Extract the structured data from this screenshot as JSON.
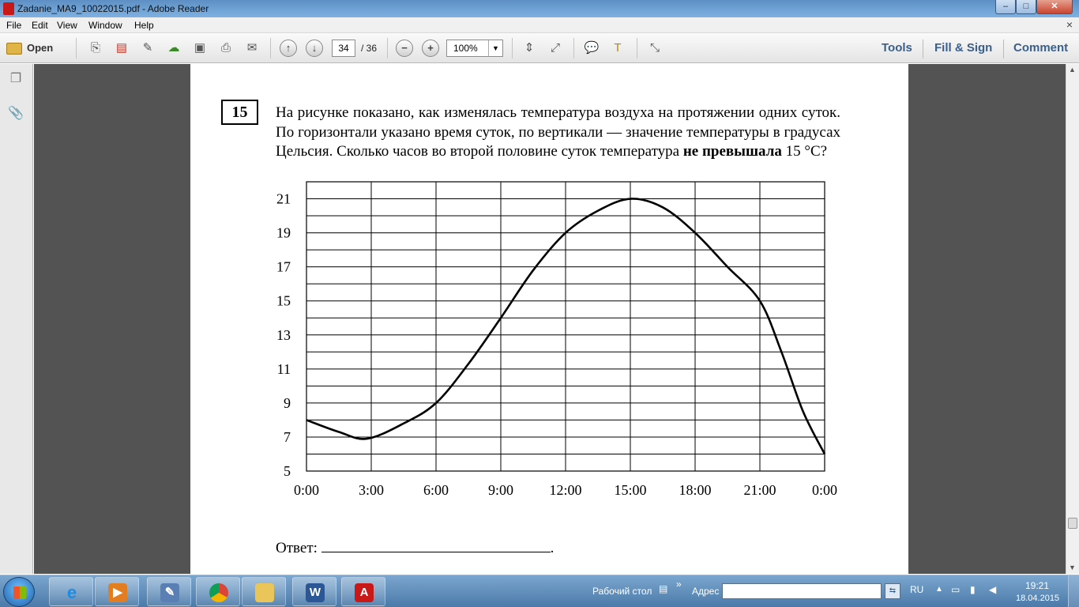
{
  "window": {
    "title": "Zadanie_MA9_10022015.pdf - Adobe Reader",
    "controls": {
      "minimize": "–",
      "maximize": "□",
      "close": "✕"
    }
  },
  "menu": {
    "items": [
      "File",
      "Edit",
      "View",
      "Window",
      "Help"
    ],
    "close_glyph": "×"
  },
  "toolbar": {
    "open_label": "Open",
    "page_current": "34",
    "page_total": "/ 36",
    "zoom": "100%",
    "right_links": [
      "Tools",
      "Fill & Sign",
      "Comment"
    ],
    "icons": [
      "create-pdf-icon",
      "export-pdf-icon",
      "edit-icon",
      "upload-cloud-icon",
      "save-icon",
      "print-icon",
      "email-icon",
      "prev-page-icon",
      "next-page-icon",
      "zoom-out-icon",
      "zoom-in-icon",
      "fit-page-icon",
      "fit-width-icon",
      "comment-icon",
      "highlight-icon",
      "fullscreen-icon"
    ]
  },
  "document": {
    "question_number": "15",
    "question_text_before_bold": "На рисунке показано, как изменялась температура воздуха на протяжении одних суток. По горизонтали указано время суток, по вертикали — значение температуры в градусах Цельсия. Сколько часов во второй половине суток температура ",
    "question_text_bold": "не превышала",
    "question_text_after_bold": " 15 °С?",
    "answer_label": "Ответ:",
    "answer_end": "."
  },
  "chart_data": {
    "type": "line",
    "title": "",
    "xlabel": "",
    "ylabel": "",
    "x_tick_labels": [
      "0:00",
      "3:00",
      "6:00",
      "9:00",
      "12:00",
      "15:00",
      "18:00",
      "21:00",
      "0:00"
    ],
    "y_tick_labels": [
      "21",
      "19",
      "17",
      "15",
      "13",
      "11",
      "9",
      "7",
      "5"
    ],
    "xlim": [
      0,
      24
    ],
    "ylim": [
      5,
      22
    ],
    "grid": true,
    "x": [
      0,
      1.5,
      2.8,
      4.5,
      6,
      7.5,
      9,
      10.5,
      12,
      13.5,
      15,
      16.5,
      18,
      19.5,
      21,
      22,
      23,
      24
    ],
    "y": [
      8,
      7.3,
      6.9,
      7.8,
      9,
      11.3,
      14,
      16.8,
      19,
      20.3,
      21,
      20.5,
      19,
      17,
      15,
      12,
      8.5,
      6
    ]
  },
  "taskbar": {
    "buttons": [
      "ie-icon",
      "media-player-icon",
      "paint-icon",
      "chrome-icon",
      "explorer-folder-icon",
      "word-icon",
      "adobe-reader-icon"
    ],
    "desktop_label": "Рабочий стол",
    "address_label": "Адрес",
    "address_value": "",
    "language": "RU",
    "time": "19:21",
    "date": "18.04.2015"
  }
}
